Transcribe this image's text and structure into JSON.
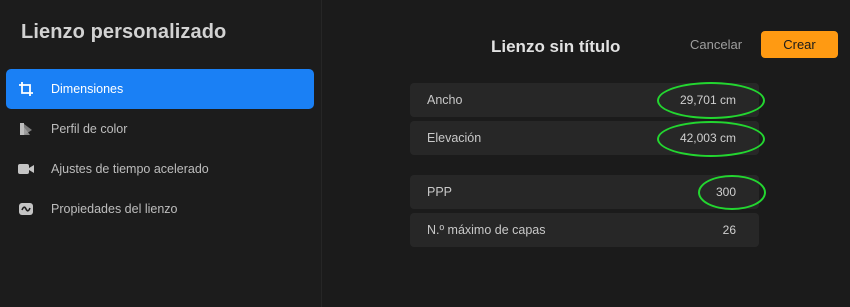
{
  "sidebar": {
    "title": "Lienzo personalizado",
    "items": [
      {
        "label": "Dimensiones",
        "icon": "crop-icon",
        "active": true
      },
      {
        "label": "Perfil de color",
        "icon": "color-profile-icon",
        "active": false
      },
      {
        "label": "Ajustes de tiempo acelerado",
        "icon": "video-camera-icon",
        "active": false
      },
      {
        "label": "Propiedades del lienzo",
        "icon": "canvas-properties-icon",
        "active": false
      }
    ]
  },
  "header": {
    "title": "Lienzo sin título",
    "cancel_label": "Cancelar",
    "create_label": "Crear"
  },
  "dimensions": [
    {
      "label": "Ancho",
      "value": "29,701 cm"
    },
    {
      "label": "Elevación",
      "value": "42,003 cm"
    }
  ],
  "resolution": [
    {
      "label": "PPP",
      "value": "300"
    },
    {
      "label": "N.º máximo de capas",
      "value": "26"
    }
  ],
  "colors": {
    "accent": "#1a80f5",
    "create_button": "#ff9a12",
    "highlight": "#23d630"
  }
}
